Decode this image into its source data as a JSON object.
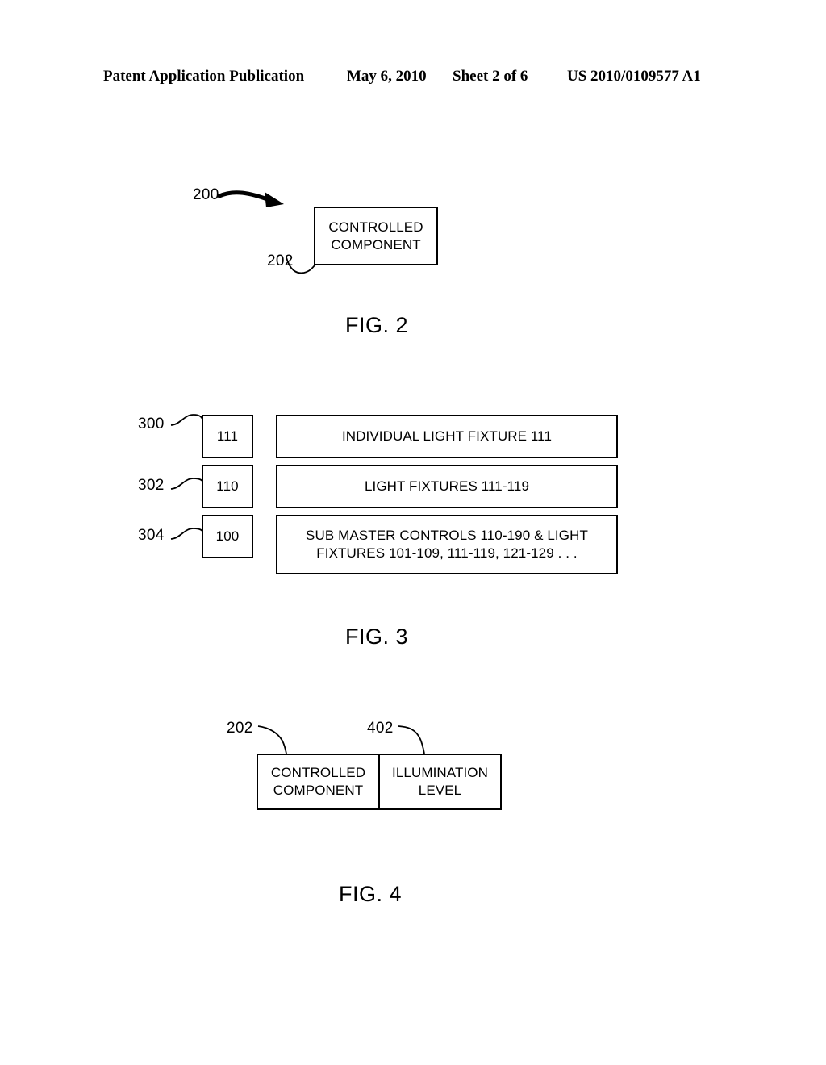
{
  "header": {
    "publication": "Patent Application Publication",
    "date": "May 6, 2010",
    "sheet": "Sheet 2 of 6",
    "patent_number": "US 2010/0109577 A1"
  },
  "figures": [
    {
      "caption": "FIG. 2",
      "reference_numerals": [
        {
          "label": "200"
        },
        {
          "label": "202"
        }
      ],
      "boxes": [
        {
          "text": "CONTROLLED\nCOMPONENT",
          "line1": "CONTROLLED",
          "line2": "COMPONENT"
        }
      ]
    },
    {
      "caption": "FIG. 3",
      "rows": [
        {
          "reference": "300",
          "id_box": "111",
          "description": "INDIVIDUAL LIGHT FIXTURE 111"
        },
        {
          "reference": "302",
          "id_box": "110",
          "description": "LIGHT FIXTURES 111-119"
        },
        {
          "reference": "304",
          "id_box": "100",
          "description_line1": "SUB MASTER CONTROLS 110-190 & LIGHT",
          "description_line2": "FIXTURES 101-109, 111-119, 121-129 . . ."
        }
      ]
    },
    {
      "caption": "FIG. 4",
      "reference_numerals": [
        {
          "label": "202"
        },
        {
          "label": "402"
        }
      ],
      "boxes": [
        {
          "line1": "CONTROLLED",
          "line2": "COMPONENT"
        },
        {
          "line1": "ILLUMINATION",
          "line2": "LEVEL"
        }
      ]
    }
  ],
  "colors": {
    "ink": "#000000",
    "paper": "#ffffff"
  }
}
